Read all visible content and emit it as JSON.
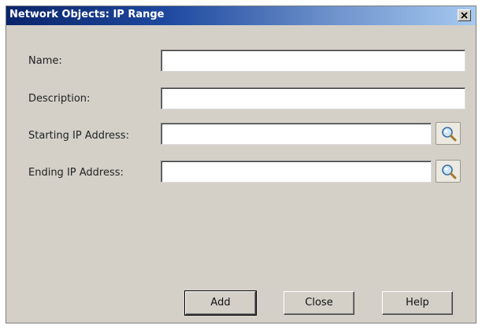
{
  "window": {
    "title": "Network Objects: IP Range",
    "close_glyph": "x"
  },
  "fields": {
    "name": {
      "label": "Name:",
      "value": ""
    },
    "description": {
      "label": "Description:",
      "value": ""
    },
    "starting_ip": {
      "label": "Starting IP Address:",
      "value": "",
      "lookup_icon": "magnifier-icon"
    },
    "ending_ip": {
      "label": "Ending IP Address:",
      "value": "",
      "lookup_icon": "magnifier-icon"
    }
  },
  "buttons": {
    "add": "Add",
    "close": "Close",
    "help": "Help"
  },
  "colors": {
    "dialog_background": "#d4d0c8",
    "title_gradient_start": "#0a246a",
    "title_gradient_end": "#a6caf0",
    "title_text": "#ffffff"
  }
}
